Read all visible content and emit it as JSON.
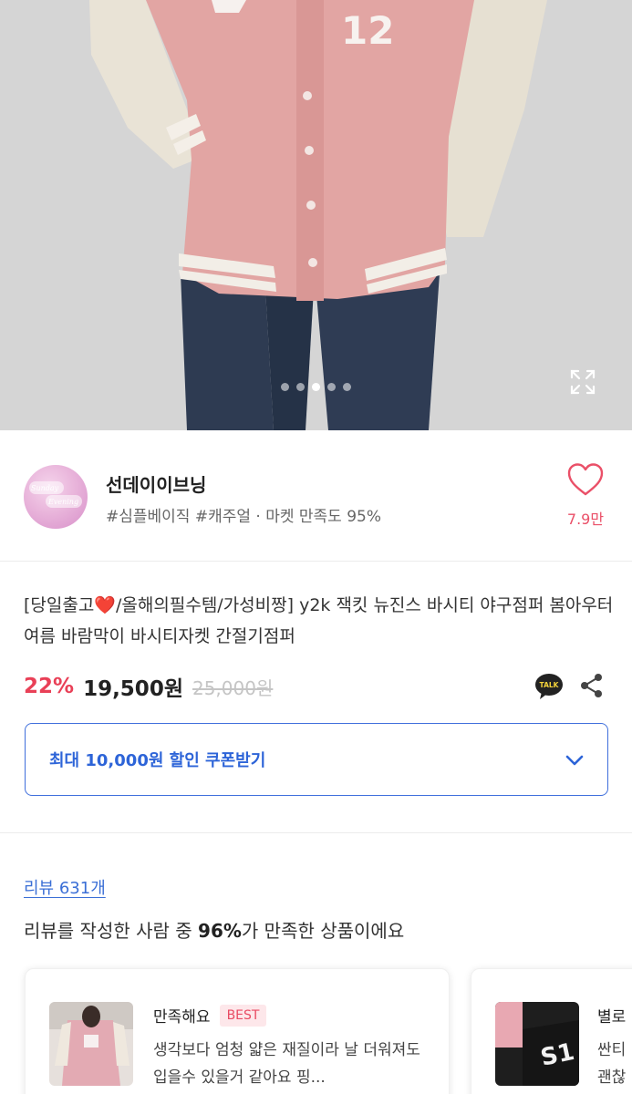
{
  "hero": {
    "jersey_number": "12",
    "slide_count": 5,
    "active_slide": 3
  },
  "seller": {
    "name": "선데이이브닝",
    "tags": "#심플베이직 #캐주얼 · 마켓 만족도 95%",
    "like_count": "7.9만",
    "logo_text_1": "Sunday",
    "logo_text_2": "Evening"
  },
  "product": {
    "title_prefix": "[당일출고",
    "title_heart": "❤️",
    "title_rest": "/올해의필수템/가성비짱] y2k 잭킷 뉴진스 바시티 야구점퍼 봄아우터 여름 바람막이 바시티자켓 간절기점퍼",
    "discount": "22%",
    "price": "19,500원",
    "original_price": "25,000원",
    "talk_label": "TALK"
  },
  "coupon": {
    "label": "최대 10,000원 할인 쿠폰받기"
  },
  "reviews": {
    "count_label": "리뷰 631개",
    "summary_prefix": "리뷰를 작성한 사람 중 ",
    "summary_percent": "96%",
    "summary_suffix": "가 만족한 상품이에요",
    "cards": [
      {
        "rating": "만족해요",
        "badge": "BEST",
        "text": "생각보다 엄청 얇은 재질이라 날 더워져도 입을수 있을거 같아요 핑..."
      },
      {
        "rating": "별로",
        "text_line1": "싼티",
        "text_line2": "괜찮"
      }
    ]
  },
  "colors": {
    "accent_blue": "#2d64d8",
    "discount_red": "#e94057",
    "heart_pink": "#ea5068"
  }
}
